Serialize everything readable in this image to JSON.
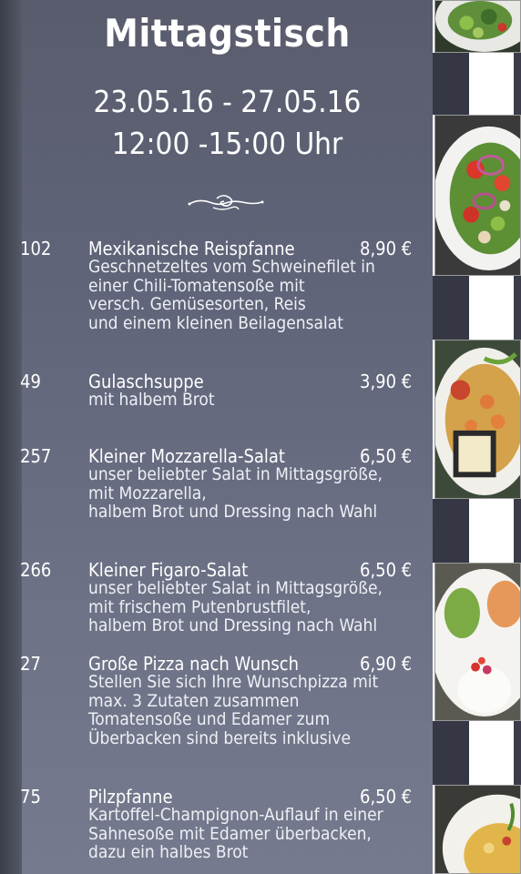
{
  "header": {
    "title": "Mittagstisch",
    "date_range": "23.05.16 - 27.05.16",
    "time_range": "12:00 -15:00 Uhr"
  },
  "menu": {
    "items": [
      {
        "number": "102",
        "name": "Mexikanische Reispfanne",
        "price": "8,90 €",
        "description": [
          "Geschnetzeltes vom Schweinefilet in",
          "einer Chili-Tomatensoße mit",
          "versch. Gemüsesorten, Reis",
          "und einem kleinen Beilagensalat"
        ]
      },
      {
        "number": "49",
        "name": "Gulaschsuppe",
        "price": "3,90 €",
        "description": [
          "mit halbem Brot"
        ]
      },
      {
        "number": "257",
        "name": "Kleiner Mozzarella-Salat",
        "price": "6,50 €",
        "description": [
          "unser beliebter Salat in Mittagsgröße,",
          "mit Mozzarella,",
          "halbem Brot und Dressing nach Wahl"
        ]
      },
      {
        "number": "266",
        "name": "Kleiner Figaro-Salat",
        "price": "6,50 €",
        "description": [
          "unser beliebter Salat in Mittagsgröße,",
          "mit frischem Putenbrustfilet,",
          "halbem Brot und Dressing nach Wahl"
        ]
      },
      {
        "number": "27",
        "name": "Große Pizza nach Wunsch",
        "price": "6,90 €",
        "description": [
          "Stellen Sie sich Ihre Wunschpizza mit",
          "max. 3 Zutaten zusammen",
          "Tomatensoße und Edamer zum",
          "Überbacken sind bereits inklusive"
        ]
      },
      {
        "number": "75",
        "name": "Pilzpfanne",
        "price": "6,50 €",
        "description": [
          "Kartoffel-Champignon-Auflauf in einer",
          "Sahnesoße mit Edamer überbacken,",
          "dazu ein halbes Brot"
        ]
      }
    ]
  },
  "colors": {
    "panel": "#61657a",
    "text": "#ffffff"
  }
}
